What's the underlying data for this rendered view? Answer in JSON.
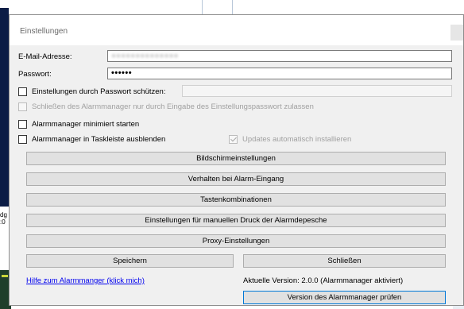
{
  "dialog": {
    "title": "Einstellungen",
    "email_label": "E-Mail-Adresse:",
    "email_value": "●●●●●●●●●●●●●●",
    "password_label": "Passwort:",
    "password_value": "••••••",
    "protect_label": "Einstellungen durch Passwort schützen:",
    "protect_checked": false,
    "close_only_label": "Schließen des Alarmmanager nur durch Eingabe des Einstellungspasswort zulassen",
    "minimized_label": "Alarmmanager minimiert starten",
    "taskbar_label": "Alarmmanager in Taskleiste ausblenden",
    "auto_updates_label": "Updates automatisch installieren",
    "auto_updates_checked": true,
    "buttons": {
      "screen": "Bildschirmeinstellungen",
      "behavior": "Verhalten bei Alarm-Eingang",
      "shortcuts": "Tastenkombinationen",
      "manual_print": "Einstellungen für manuellen Druck der Alarmdepesche",
      "proxy": "Proxy-Einstellungen",
      "save": "Speichern",
      "close": "Schließen",
      "check_version": "Version des Alarmmanager prüfen"
    },
    "help_link": "Hilfe zum Alarmmanger (klick mich)",
    "version_text": "Aktuelle Version: 2.0.0 (Alarmmanager aktiviert)"
  },
  "background": {
    "side_text_1": "dg",
    "side_text_2": ":0"
  }
}
